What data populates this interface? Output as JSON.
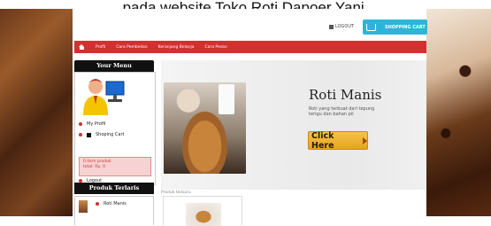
{
  "caption": "pada website Toko Roti Dapoer Yani.",
  "header": {
    "login_label": "LOGOUT",
    "cart_button_label": "SHOPPING CART"
  },
  "nav": {
    "items": [
      "Profil",
      "Cara Pembelian",
      "Keranjang Belanja",
      "Cara Pesan"
    ]
  },
  "sidebar": {
    "menu_title": "Your Menu",
    "menu_items": [
      "My Profil",
      "Shoping Cart"
    ],
    "cart_info_line1": "0 item produk",
    "cart_info_line2": "total: Rp. 0",
    "logout_label": "Logout",
    "best_title": "Produk Terlaris",
    "best_items": [
      "Roti Manis"
    ]
  },
  "banner": {
    "title": "Roti Manis",
    "description": "Roti yang terbuat dari tepung terigu dan bahan pil",
    "cta_label": "Click Here"
  },
  "main": {
    "new_products_label": "Produk terbaru"
  },
  "colors": {
    "nav_red": "#d23131",
    "cart_blue": "#2cb5d8",
    "cta_orange": "#f6c24a"
  }
}
